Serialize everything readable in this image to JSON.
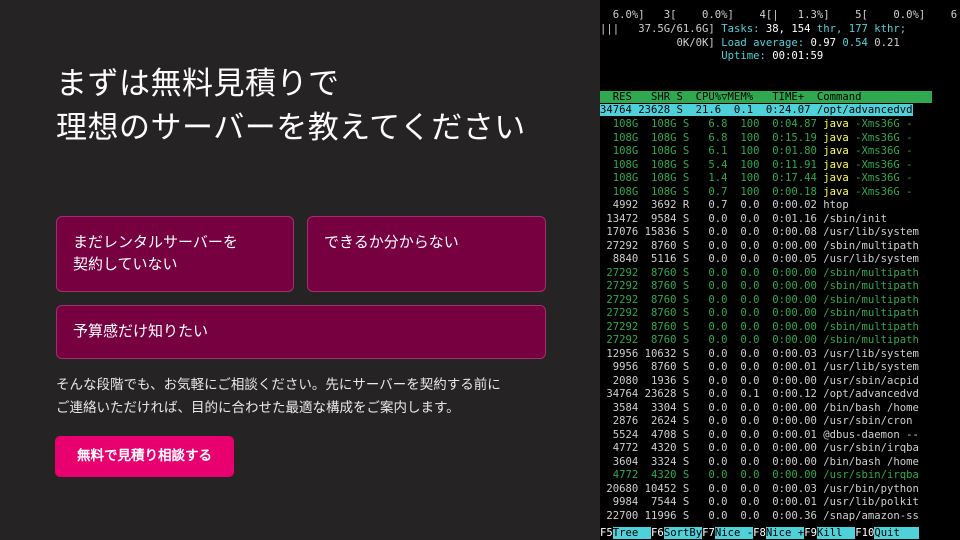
{
  "hero": {
    "headline_lines": [
      "まずは無料見積りで",
      "理想のサーバーを教えてください"
    ],
    "cards": [
      {
        "lines": [
          "まだレンタルサーバーを",
          "契約していない"
        ]
      },
      {
        "lines": [
          "できるか分からない"
        ]
      },
      {
        "lines": [
          "予算感だけ知りたい"
        ]
      }
    ],
    "description_lines": [
      "そんな段階でも、お気軽にご相談ください。先にサーバーを契約する前に",
      "ご連絡いただければ、目的に合わせた最適な構成をご案内します。"
    ],
    "cta_label": "無料で見積り相談する",
    "colors": {
      "background": "#252323",
      "card": "#760040",
      "card_border": "#a0306a",
      "cta": "#e8006f",
      "text": "#ffffff"
    }
  },
  "terminal": {
    "lines": [
      [
        [
          "  6.0%]   3[    0.0%]    4[|   1.3%]    5[    0.0%]    6",
          "#d0d0d0"
        ]
      ],
      [
        [
          "|||   37.5G/61.6G] ",
          "#d0d0d0"
        ],
        [
          "Tasks: ",
          "#4fd1d9"
        ],
        [
          "38, 154",
          "#ffffff"
        ],
        [
          " thr, 177 kthr;",
          "#4fd1d9"
        ]
      ],
      [
        [
          "            0K/0K] ",
          "#d0d0d0"
        ],
        [
          "Load average: ",
          "#4fd1d9"
        ],
        [
          "0.97 ",
          "#ffffff"
        ],
        [
          "0.54 ",
          "#4fd1d9"
        ],
        [
          "0.21",
          "#d0d0d0"
        ]
      ],
      [
        [
          "                   ",
          "#d0d0d0"
        ],
        [
          "Uptime: ",
          "#4fd1d9"
        ],
        [
          "00:01:59",
          "#ffffff"
        ]
      ],
      [
        [
          "",
          "#d0d0d0"
        ]
      ],
      [
        [
          "",
          "#d0d0d0"
        ]
      ],
      [
        [
          "",
          "#d0d0d0"
        ]
      ],
      [
        [
          "  RES   SHR S  CPU%▽MEM%   TIME+  Command           ",
          "#000000",
          "#2fa84f"
        ]
      ],
      [
        [
          "34764 23628 S  21.6  0.1  0:24.07 /opt/advancedvd",
          "#000000",
          "#4fd1d9"
        ]
      ],
      [
        [
          "  108G  108G S   6.8  100  0:04.87 ",
          "#2fa84f"
        ],
        [
          "java",
          "#ffff55"
        ],
        [
          " -Xms36G -",
          "#2fa84f"
        ]
      ],
      [
        [
          "  108G  108G S   6.8  100  0:15.19 ",
          "#2fa84f"
        ],
        [
          "java",
          "#ffff55"
        ],
        [
          " -Xms36G -",
          "#2fa84f"
        ]
      ],
      [
        [
          "  108G  108G S   6.1  100  0:01.80 ",
          "#2fa84f"
        ],
        [
          "java",
          "#ffff55"
        ],
        [
          " -Xms36G -",
          "#2fa84f"
        ]
      ],
      [
        [
          "  108G  108G S   5.4  100  0:11.91 ",
          "#2fa84f"
        ],
        [
          "java",
          "#ffff55"
        ],
        [
          " -Xms36G -",
          "#2fa84f"
        ]
      ],
      [
        [
          "  108G  108G S   1.4  100  0:17.44 ",
          "#2fa84f"
        ],
        [
          "java",
          "#ffff55"
        ],
        [
          " -Xms36G -",
          "#2fa84f"
        ]
      ],
      [
        [
          "  108G  108G S   0.7  100  0:00.18 ",
          "#2fa84f"
        ],
        [
          "java",
          "#ffff55"
        ],
        [
          " -Xms36G -",
          "#2fa84f"
        ]
      ],
      [
        [
          "  4992  3692 R   0.7  0.0  0:00.02 htop",
          "#d0d0d0"
        ]
      ],
      [
        [
          " 13472  9584 S   0.0  0.0  0:01.16 /sbin/init",
          "#d0d0d0"
        ]
      ],
      [
        [
          " 17076 15836 S   0.0  0.0  0:00.08 /usr/lib/system",
          "#d0d0d0"
        ]
      ],
      [
        [
          " 27292  8760 S   0.0  0.0  0:00.00 /sbin/multipath",
          "#d0d0d0"
        ]
      ],
      [
        [
          "  8840  5116 S   0.0  0.0  0:00.05 /usr/lib/system",
          "#d0d0d0"
        ]
      ],
      [
        [
          " 27292  8760 S   0.0  0.0  0:00.00 /sbin/multipath",
          "#2fa84f"
        ]
      ],
      [
        [
          " 27292  8760 S   0.0  0.0  0:00.00 /sbin/multipath",
          "#2fa84f"
        ]
      ],
      [
        [
          " 27292  8760 S   0.0  0.0  0:00.00 /sbin/multipath",
          "#2fa84f"
        ]
      ],
      [
        [
          " 27292  8760 S   0.0  0.0  0:00.00 /sbin/multipath",
          "#2fa84f"
        ]
      ],
      [
        [
          " 27292  8760 S   0.0  0.0  0:00.00 /sbin/multipath",
          "#2fa84f"
        ]
      ],
      [
        [
          " 27292  8760 S   0.0  0.0  0:00.00 /sbin/multipath",
          "#2fa84f"
        ]
      ],
      [
        [
          " 12956 10632 S   0.0  0.0  0:00.03 /usr/lib/system",
          "#d0d0d0"
        ]
      ],
      [
        [
          "  9956  8760 S   0.0  0.0  0:00.01 /usr/lib/system",
          "#d0d0d0"
        ]
      ],
      [
        [
          "  2080  1936 S   0.0  0.0  0:00.00 /usr/sbin/acpid",
          "#d0d0d0"
        ]
      ],
      [
        [
          " 34764 23628 S   0.0  0.1  0:00.12 /opt/advancedvd",
          "#d0d0d0"
        ]
      ],
      [
        [
          "  3584  3304 S   0.0  0.0  0:00.00 /bin/bash /home",
          "#d0d0d0"
        ]
      ],
      [
        [
          "  2876  2624 S   0.0  0.0  0:00.00 /usr/sbin/cron",
          "#d0d0d0"
        ]
      ],
      [
        [
          "  5524  4708 S   0.0  0.0  0:00.01 @dbus-daemon --",
          "#d0d0d0"
        ]
      ],
      [
        [
          "  4772  4320 S   0.0  0.0  0:00.00 /usr/sbin/irqba",
          "#d0d0d0"
        ]
      ],
      [
        [
          "  3604  3324 S   0.0  0.0  0:00.00 /bin/bash /home",
          "#d0d0d0"
        ]
      ],
      [
        [
          "  4772  4320 S   0.0  0.0  0:00.00 /usr/sbin/irqba",
          "#2fa84f"
        ]
      ],
      [
        [
          " 20680 10452 S   0.0  0.0  0:00.03 /usr/bin/python",
          "#d0d0d0"
        ]
      ],
      [
        [
          "  9984  7544 S   0.0  0.0  0:00.01 /usr/lib/polkit",
          "#d0d0d0"
        ]
      ],
      [
        [
          " 22700 11996 S   0.0  0.0  0:00.36 /snap/amazon-ss",
          "#d0d0d0"
        ]
      ],
      [
        [
          "F5",
          "#ffffff"
        ],
        [
          "Tree  ",
          "#000000",
          "#4fd1d9"
        ],
        [
          "F6",
          "#ffffff"
        ],
        [
          "SortBy",
          "#000000",
          "#4fd1d9"
        ],
        [
          "F7",
          "#ffffff"
        ],
        [
          "Nice -",
          "#000000",
          "#4fd1d9"
        ],
        [
          "F8",
          "#ffffff"
        ],
        [
          "Nice +",
          "#000000",
          "#4fd1d9"
        ],
        [
          "F9",
          "#ffffff"
        ],
        [
          "Kill  ",
          "#000000",
          "#4fd1d9"
        ],
        [
          "F10",
          "#ffffff"
        ],
        [
          "Quit   ",
          "#000000",
          "#4fd1d9"
        ]
      ]
    ]
  }
}
